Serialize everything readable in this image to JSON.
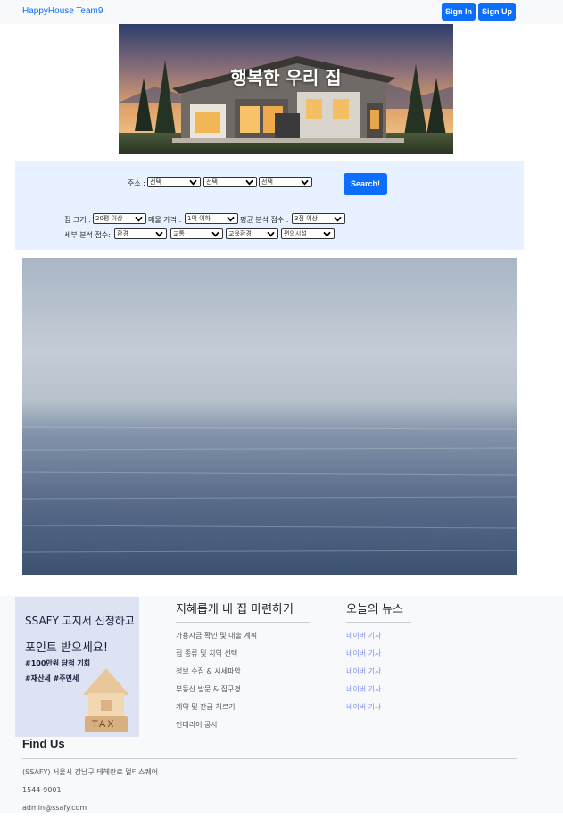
{
  "navbar": {
    "brand": "HappyHouse Team9",
    "signin_label": "Sign In",
    "signup_label": "Sign Up",
    "button_color": "#0d6efd"
  },
  "hero": {
    "title": "행복한 우리 집"
  },
  "search": {
    "address_label": "주소 :",
    "address_selects": [
      "선택",
      "선택",
      "선택"
    ],
    "button_label": "Search!",
    "size_label": "집 크기 :",
    "size_value": "20평 이상",
    "price_label": "매물 가격 :",
    "price_value": "1억 이하",
    "avg_label": "평균 분석 점수 :",
    "avg_value": "3점 이상",
    "detail_label": "세부 분석 점수:",
    "detail_selects": [
      "환경",
      "교통",
      "교육환경",
      "편의시설"
    ],
    "panel_color": "#e7f1ff"
  },
  "ad": {
    "line1": "SSAFY 고지서 신청하고",
    "line2": "포인트 받으세요!",
    "line3": "#100만원 당첨 기회",
    "line4": "#재산세 #주민세",
    "tax_text": "TAX"
  },
  "footer": {
    "guide": {
      "title": "지혜롭게 내 집 마련하기",
      "items": [
        "가용자금 확인 및 대출 계획",
        "집 종류 및 지역 선택",
        "정보 수집 & 시세파악",
        "부동산 방문 & 집구경",
        "계약 및 잔금 치르기",
        "인테리어 공사"
      ]
    },
    "news": {
      "title": "오늘의 뉴스",
      "items": [
        "네이버 기사",
        "네이버 기사",
        "네이버 기사",
        "네이버 기사",
        "네이버 기사"
      ],
      "link_color": "#7e8ff0"
    },
    "find_us": {
      "title": "Find Us",
      "address": "(SSAFY) 서울시 강남구 테헤란로 멀티스퀘어",
      "phone": "1544-9001",
      "email": "admin@ssafy.com"
    }
  }
}
